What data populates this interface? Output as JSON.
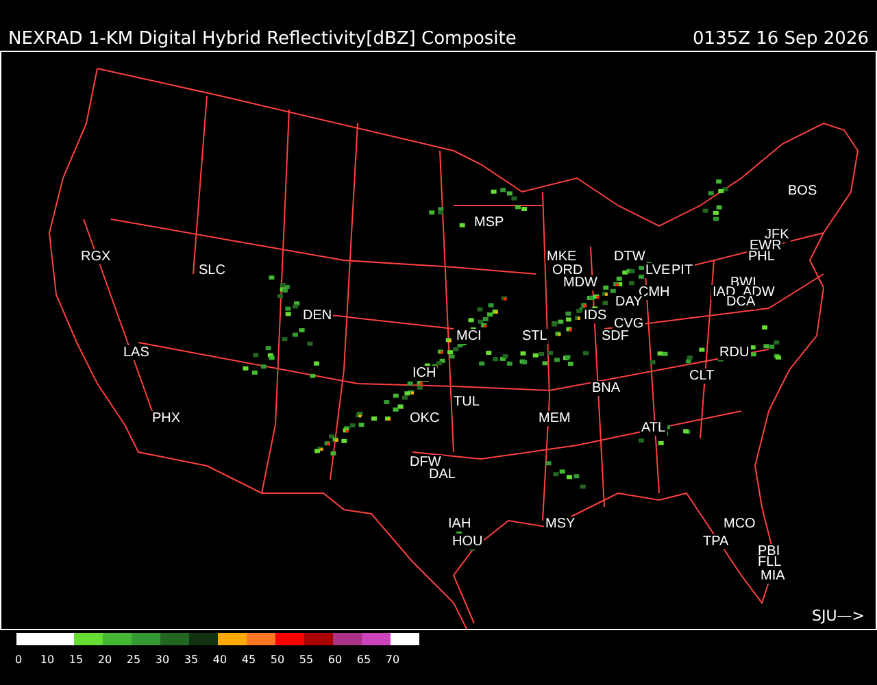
{
  "header": {
    "title": "NEXRAD 1-KM Digital Hybrid Reflectivity[dBZ] Composite",
    "time": "0135Z 16 Sep 2026"
  },
  "map": {
    "cities": [
      "BOS",
      "MSP",
      "JFK",
      "EWR",
      "RGX",
      "MKE",
      "DTW",
      "PHL",
      "SLC",
      "ORD",
      "LVE",
      "PIT",
      "MDW",
      "BWI",
      "CMH",
      "IAD",
      "ADW",
      "DAY",
      "DCA",
      "DEN",
      "IDS",
      "CVG",
      "MCI",
      "STL",
      "SDF",
      "LAS",
      "RDU",
      "ICH",
      "CLT",
      "BNA",
      "TUL",
      "PHX",
      "OKC",
      "MEM",
      "ATL",
      "DFW",
      "DAL",
      "IAH",
      "MSY",
      "MCO",
      "HOU",
      "TPA",
      "PBI",
      "FLL",
      "MIA"
    ],
    "offmap_label": "SJU—>"
  },
  "legend": {
    "segments": [
      {
        "color": "#ffffff"
      },
      {
        "color": "#66dd33"
      },
      {
        "color": "#44b833"
      },
      {
        "color": "#339933"
      },
      {
        "color": "#226622"
      },
      {
        "color": "#113311"
      },
      {
        "color": "#ffaa00"
      },
      {
        "color": "#ff7722"
      },
      {
        "color": "#ff0000"
      },
      {
        "color": "#aa0000"
      },
      {
        "color": "#aa3388"
      },
      {
        "color": "#cc44bb"
      },
      {
        "color": "#ffffff"
      }
    ],
    "ticks": [
      "0",
      "10",
      "15",
      "20",
      "25",
      "30",
      "35",
      "40",
      "45",
      "50",
      "55",
      "60",
      "65",
      "70"
    ]
  }
}
